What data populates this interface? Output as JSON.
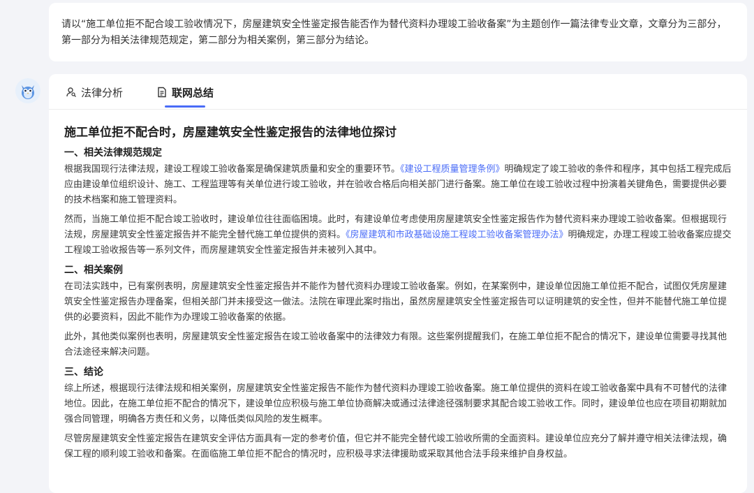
{
  "prompt": {
    "text": "请以“施工单位拒不配合竣工验收情况下，房屋建筑安全性鉴定报告能否作为替代资料办理竣工验收备案”为主题创作一篇法律专业文章，文章分为三部分，第一部分为相关法律规范规定，第二部分为相关案例，第三部分为结论。"
  },
  "tabs": [
    {
      "label": "法律分析",
      "icon": "person-search-icon"
    },
    {
      "label": "联网总结",
      "icon": "document-icon",
      "active": true
    }
  ],
  "article": {
    "title": "施工单位拒不配合时，房屋建筑安全性鉴定报告的法律地位探讨",
    "sections": [
      {
        "heading": "一、相关法律规范规定",
        "paragraphs": [
          {
            "a": "根据我国现行法律法规，建设工程竣工验收备案是确保建筑质量和安全的重要环节。",
            "link": "《建设工程质量管理条例》",
            "b": "明确规定了竣工验收的条件和程序，其中包括工程完成后应由建设单位组织设计、施工、工程监理等有关单位进行竣工验收，并在验收合格后向相关部门进行备案。施工单位在竣工验收过程中扮演着关键角色，需要提供必要的技术档案和施工管理资料。"
          },
          {
            "a": "然而，当施工单位拒不配合竣工验收时，建设单位往往面临困境。此时，有建设单位考虑使用房屋建筑安全性鉴定报告作为替代资料来办理竣工验收备案。但根据现行法规，房屋建筑安全性鉴定报告并不能完全替代施工单位提供的资料。",
            "link": "《房屋建筑和市政基础设施工程竣工验收备案管理办法》",
            "b": "明确规定，办理工程竣工验收备案应提交工程竣工验收报告等一系列文件，而房屋建筑安全性鉴定报告并未被列入其中。"
          }
        ]
      },
      {
        "heading": "二、相关案例",
        "paragraphs": [
          {
            "a": "在司法实践中，已有案例表明，房屋建筑安全性鉴定报告并不能作为替代资料办理竣工验收备案。例如，在某案例中，建设单位因施工单位拒不配合，试图仅凭房屋建筑安全性鉴定报告办理备案，但相关部门并未接受这一做法。法院在审理此案时指出，虽然房屋建筑安全性鉴定报告可以证明建筑的安全性，但并不能替代施工单位提供的必要资料，因此不能作为办理竣工验收备案的依据。",
            "link": "",
            "b": ""
          },
          {
            "a": "此外，其他类似案例也表明，房屋建筑安全性鉴定报告在竣工验收备案中的法律效力有限。这些案例提醒我们，在施工单位拒不配合的情况下，建设单位需要寻找其他合法途径来解决问题。",
            "link": "",
            "b": ""
          }
        ]
      },
      {
        "heading": "三、结论",
        "paragraphs": [
          {
            "a": "综上所述，根据现行法律法规和相关案例，房屋建筑安全性鉴定报告不能作为替代资料办理竣工验收备案。施工单位提供的资料在竣工验收备案中具有不可替代的法律地位。因此，在施工单位拒不配合的情况下，建设单位应积极与施工单位协商解决或通过法律途径强制要求其配合竣工验收工作。同时，建设单位也应在项目初期就加强合同管理，明确各方责任和义务，以降低类似风险的发生概率。",
            "link": "",
            "b": ""
          },
          {
            "a": "尽管房屋建筑安全性鉴定报告在建筑安全评估方面具有一定的参考价值，但它并不能完全替代竣工验收所需的全面资料。建设单位应充分了解并遵守相关法律法规，确保工程的顺利竣工验收和备案。在面临施工单位拒不配合的情况时，应积极寻求法律援助或采取其他合法手段来维护自身权益。",
            "link": "",
            "b": ""
          }
        ]
      }
    ]
  }
}
